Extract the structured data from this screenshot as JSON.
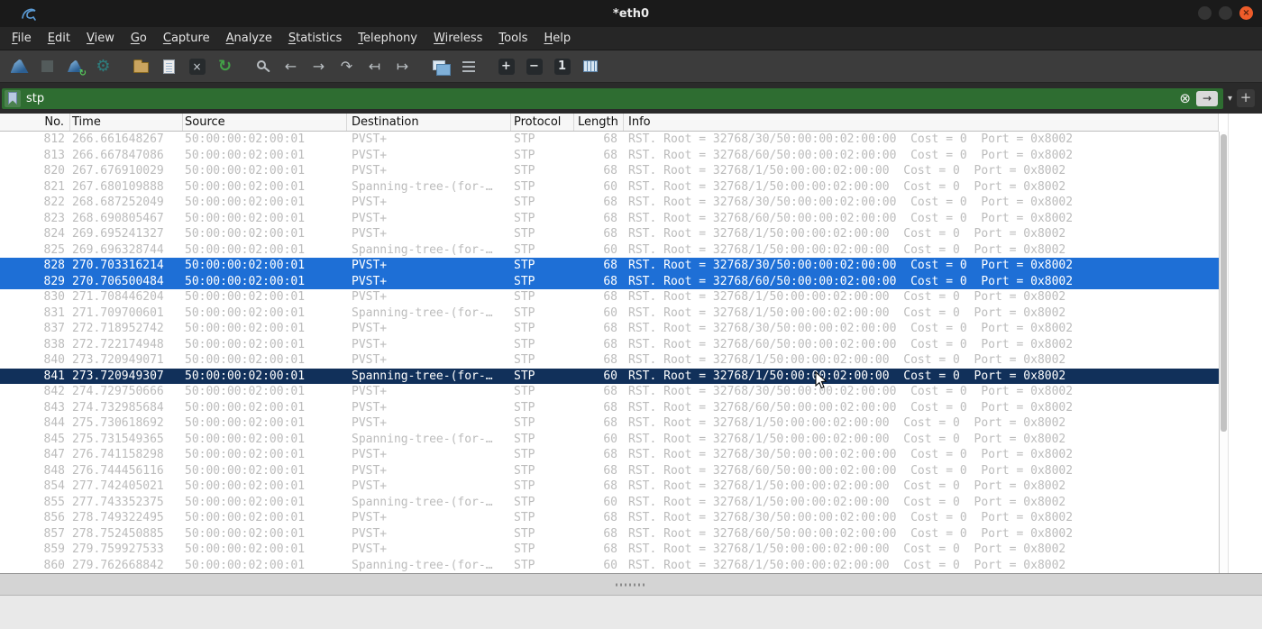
{
  "window": {
    "title": "*eth0",
    "close_glyph": "×"
  },
  "menu": {
    "items": [
      "File",
      "Edit",
      "View",
      "Go",
      "Capture",
      "Analyze",
      "Statistics",
      "Telephony",
      "Wireless",
      "Tools",
      "Help"
    ]
  },
  "toolbar": {
    "groups": [
      [
        {
          "name": "capture-start-icon"
        },
        {
          "name": "capture-stop-icon",
          "glyph": "■"
        },
        {
          "name": "capture-restart-icon",
          "sub": "↻"
        },
        {
          "name": "capture-options-icon",
          "glyph": "⚙"
        }
      ],
      [
        {
          "name": "open-file-icon"
        },
        {
          "name": "save-file-icon"
        },
        {
          "name": "close-file-icon",
          "glyph": "×"
        },
        {
          "name": "reload-icon",
          "glyph": "↻"
        }
      ],
      [
        {
          "name": "find-icon"
        },
        {
          "name": "back-icon",
          "glyph": "←"
        },
        {
          "name": "forward-icon",
          "glyph": "→"
        },
        {
          "name": "goto-packet-icon",
          "glyph": "↷"
        },
        {
          "name": "prev-packet-icon",
          "glyph": "↤"
        },
        {
          "name": "next-packet-icon",
          "glyph": "↦"
        }
      ],
      [
        {
          "name": "colorize-icon"
        },
        {
          "name": "autoscroll-icon"
        }
      ],
      [
        {
          "name": "zoom-in-icon",
          "glyph": "+"
        },
        {
          "name": "zoom-out-icon",
          "glyph": "−"
        },
        {
          "name": "zoom-original-icon",
          "glyph": "1"
        },
        {
          "name": "resize-columns-icon"
        }
      ]
    ]
  },
  "filter": {
    "value": "stp",
    "clear_glyph": "⊗",
    "apply_glyph": "→",
    "dropdown_glyph": "▾",
    "add_glyph": "+"
  },
  "table": {
    "columns": [
      "No.",
      "Time",
      "Source",
      "Destination",
      "Protocol",
      "Length",
      "Info"
    ],
    "rows": [
      {
        "no": 812,
        "time": "266.661648267",
        "source": "50:00:00:02:00:01",
        "destination": "PVST+",
        "protocol": "STP",
        "length": 68,
        "info": "RST. Root = 32768/30/50:00:00:02:00:00  Cost = 0  Port = 0x8002",
        "state": ""
      },
      {
        "no": 813,
        "time": "266.667847086",
        "source": "50:00:00:02:00:01",
        "destination": "PVST+",
        "protocol": "STP",
        "length": 68,
        "info": "RST. Root = 32768/60/50:00:00:02:00:00  Cost = 0  Port = 0x8002",
        "state": ""
      },
      {
        "no": 820,
        "time": "267.676910029",
        "source": "50:00:00:02:00:01",
        "destination": "PVST+",
        "protocol": "STP",
        "length": 68,
        "info": "RST. Root = 32768/1/50:00:00:02:00:00  Cost = 0  Port = 0x8002",
        "state": ""
      },
      {
        "no": 821,
        "time": "267.680109888",
        "source": "50:00:00:02:00:01",
        "destination": "Spanning-tree-(for-…",
        "protocol": "STP",
        "length": 60,
        "info": "RST. Root = 32768/1/50:00:00:02:00:00  Cost = 0  Port = 0x8002",
        "state": ""
      },
      {
        "no": 822,
        "time": "268.687252049",
        "source": "50:00:00:02:00:01",
        "destination": "PVST+",
        "protocol": "STP",
        "length": 68,
        "info": "RST. Root = 32768/30/50:00:00:02:00:00  Cost = 0  Port = 0x8002",
        "state": ""
      },
      {
        "no": 823,
        "time": "268.690805467",
        "source": "50:00:00:02:00:01",
        "destination": "PVST+",
        "protocol": "STP",
        "length": 68,
        "info": "RST. Root = 32768/60/50:00:00:02:00:00  Cost = 0  Port = 0x8002",
        "state": ""
      },
      {
        "no": 824,
        "time": "269.695241327",
        "source": "50:00:00:02:00:01",
        "destination": "PVST+",
        "protocol": "STP",
        "length": 68,
        "info": "RST. Root = 32768/1/50:00:00:02:00:00  Cost = 0  Port = 0x8002",
        "state": ""
      },
      {
        "no": 825,
        "time": "269.696328744",
        "source": "50:00:00:02:00:01",
        "destination": "Spanning-tree-(for-…",
        "protocol": "STP",
        "length": 60,
        "info": "RST. Root = 32768/1/50:00:00:02:00:00  Cost = 0  Port = 0x8002",
        "state": ""
      },
      {
        "no": 828,
        "time": "270.703316214",
        "source": "50:00:00:02:00:01",
        "destination": "PVST+",
        "protocol": "STP",
        "length": 68,
        "info": "RST. Root = 32768/30/50:00:00:02:00:00  Cost = 0  Port = 0x8002",
        "state": "highlighted"
      },
      {
        "no": 829,
        "time": "270.706500484",
        "source": "50:00:00:02:00:01",
        "destination": "PVST+",
        "protocol": "STP",
        "length": 68,
        "info": "RST. Root = 32768/60/50:00:00:02:00:00  Cost = 0  Port = 0x8002",
        "state": "highlighted"
      },
      {
        "no": 830,
        "time": "271.708446204",
        "source": "50:00:00:02:00:01",
        "destination": "PVST+",
        "protocol": "STP",
        "length": 68,
        "info": "RST. Root = 32768/1/50:00:00:02:00:00  Cost = 0  Port = 0x8002",
        "state": ""
      },
      {
        "no": 831,
        "time": "271.709700601",
        "source": "50:00:00:02:00:01",
        "destination": "Spanning-tree-(for-…",
        "protocol": "STP",
        "length": 60,
        "info": "RST. Root = 32768/1/50:00:00:02:00:00  Cost = 0  Port = 0x8002",
        "state": ""
      },
      {
        "no": 837,
        "time": "272.718952742",
        "source": "50:00:00:02:00:01",
        "destination": "PVST+",
        "protocol": "STP",
        "length": 68,
        "info": "RST. Root = 32768/30/50:00:00:02:00:00  Cost = 0  Port = 0x8002",
        "state": ""
      },
      {
        "no": 838,
        "time": "272.722174948",
        "source": "50:00:00:02:00:01",
        "destination": "PVST+",
        "protocol": "STP",
        "length": 68,
        "info": "RST. Root = 32768/60/50:00:00:02:00:00  Cost = 0  Port = 0x8002",
        "state": ""
      },
      {
        "no": 840,
        "time": "273.720949071",
        "source": "50:00:00:02:00:01",
        "destination": "PVST+",
        "protocol": "STP",
        "length": 68,
        "info": "RST. Root = 32768/1/50:00:00:02:00:00  Cost = 0  Port = 0x8002",
        "state": ""
      },
      {
        "no": 841,
        "time": "273.720949307",
        "source": "50:00:00:02:00:01",
        "destination": "Spanning-tree-(for-…",
        "protocol": "STP",
        "length": 60,
        "info": "RST. Root = 32768/1/50:00:00:02:00:00  Cost = 0  Port = 0x8002",
        "state": "selected"
      },
      {
        "no": 842,
        "time": "274.729750666",
        "source": "50:00:00:02:00:01",
        "destination": "PVST+",
        "protocol": "STP",
        "length": 68,
        "info": "RST. Root = 32768/30/50:00:00:02:00:00  Cost = 0  Port = 0x8002",
        "state": ""
      },
      {
        "no": 843,
        "time": "274.732985684",
        "source": "50:00:00:02:00:01",
        "destination": "PVST+",
        "protocol": "STP",
        "length": 68,
        "info": "RST. Root = 32768/60/50:00:00:02:00:00  Cost = 0  Port = 0x8002",
        "state": ""
      },
      {
        "no": 844,
        "time": "275.730618692",
        "source": "50:00:00:02:00:01",
        "destination": "PVST+",
        "protocol": "STP",
        "length": 68,
        "info": "RST. Root = 32768/1/50:00:00:02:00:00  Cost = 0  Port = 0x8002",
        "state": ""
      },
      {
        "no": 845,
        "time": "275.731549365",
        "source": "50:00:00:02:00:01",
        "destination": "Spanning-tree-(for-…",
        "protocol": "STP",
        "length": 60,
        "info": "RST. Root = 32768/1/50:00:00:02:00:00  Cost = 0  Port = 0x8002",
        "state": ""
      },
      {
        "no": 847,
        "time": "276.741158298",
        "source": "50:00:00:02:00:01",
        "destination": "PVST+",
        "protocol": "STP",
        "length": 68,
        "info": "RST. Root = 32768/30/50:00:00:02:00:00  Cost = 0  Port = 0x8002",
        "state": ""
      },
      {
        "no": 848,
        "time": "276.744456116",
        "source": "50:00:00:02:00:01",
        "destination": "PVST+",
        "protocol": "STP",
        "length": 68,
        "info": "RST. Root = 32768/60/50:00:00:02:00:00  Cost = 0  Port = 0x8002",
        "state": ""
      },
      {
        "no": 854,
        "time": "277.742405021",
        "source": "50:00:00:02:00:01",
        "destination": "PVST+",
        "protocol": "STP",
        "length": 68,
        "info": "RST. Root = 32768/1/50:00:00:02:00:00  Cost = 0  Port = 0x8002",
        "state": ""
      },
      {
        "no": 855,
        "time": "277.743352375",
        "source": "50:00:00:02:00:01",
        "destination": "Spanning-tree-(for-…",
        "protocol": "STP",
        "length": 60,
        "info": "RST. Root = 32768/1/50:00:00:02:00:00  Cost = 0  Port = 0x8002",
        "state": ""
      },
      {
        "no": 856,
        "time": "278.749322495",
        "source": "50:00:00:02:00:01",
        "destination": "PVST+",
        "protocol": "STP",
        "length": 68,
        "info": "RST. Root = 32768/30/50:00:00:02:00:00  Cost = 0  Port = 0x8002",
        "state": ""
      },
      {
        "no": 857,
        "time": "278.752450885",
        "source": "50:00:00:02:00:01",
        "destination": "PVST+",
        "protocol": "STP",
        "length": 68,
        "info": "RST. Root = 32768/60/50:00:00:02:00:00  Cost = 0  Port = 0x8002",
        "state": ""
      },
      {
        "no": 859,
        "time": "279.759927533",
        "source": "50:00:00:02:00:01",
        "destination": "PVST+",
        "protocol": "STP",
        "length": 68,
        "info": "RST. Root = 32768/1/50:00:00:02:00:00  Cost = 0  Port = 0x8002",
        "state": ""
      },
      {
        "no": 860,
        "time": "279.762668842",
        "source": "50:00:00:02:00:01",
        "destination": "Spanning-tree-(for-…",
        "protocol": "STP",
        "length": 60,
        "info": "RST. Root = 32768/1/50:00:00:02:00:00  Cost = 0  Port = 0x8002",
        "state": ""
      }
    ]
  },
  "colors": {
    "title_bar_bg": "#1a1a1a",
    "menu_bar_bg": "#262626",
    "toolbar_bg": "#3c3c3c",
    "filter_bar_bg": "#2a2a2a",
    "filter_valid_bg": "#2e6d31",
    "header_bg": "#f7f7f7",
    "row_text_dim": "#bcbcbc",
    "row_highlight_bg": "#1e6fd6",
    "row_selected_bg": "#11305a",
    "close_button": "#ee5c2a"
  }
}
